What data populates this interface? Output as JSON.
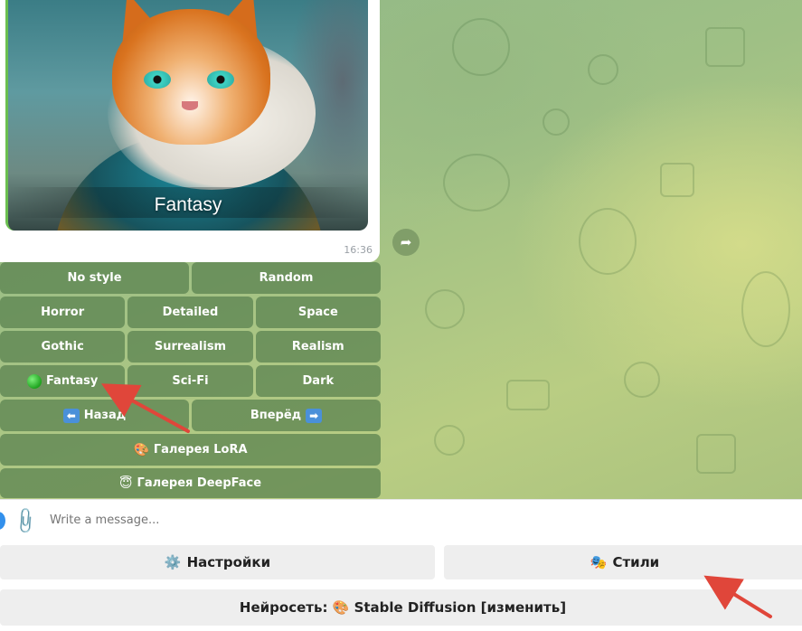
{
  "message": {
    "image_caption": "Fantasy",
    "time": "16:36"
  },
  "inline_keyboard": {
    "rows": [
      [
        "No style",
        "Random"
      ],
      [
        "Horror",
        "Detailed",
        "Space"
      ],
      [
        "Gothic",
        "Surrealism",
        "Realism"
      ],
      [
        "Fantasy",
        "Sci-Fi",
        "Dark"
      ],
      [
        "Назад",
        "Вперёд"
      ],
      [
        "Галерея LoRA"
      ],
      [
        "Галерея DeepFace"
      ]
    ]
  },
  "composer": {
    "placeholder": "Write a message..."
  },
  "reply_keyboard": {
    "settings": "Настройки",
    "styles": "Стили",
    "network": "Нейросеть: 🎨 Stable Diffusion [изменить]"
  },
  "colors": {
    "accent": "#3390ec",
    "annotation": "#e0463a",
    "selected_indicator": "#1fa31f"
  },
  "icons": {
    "forward": "forward-icon",
    "attach": "paperclip-icon",
    "settings": "gear-icon",
    "styles": "theater-masks-icon",
    "lora": "palette-icon",
    "deepface": "face-icon"
  }
}
